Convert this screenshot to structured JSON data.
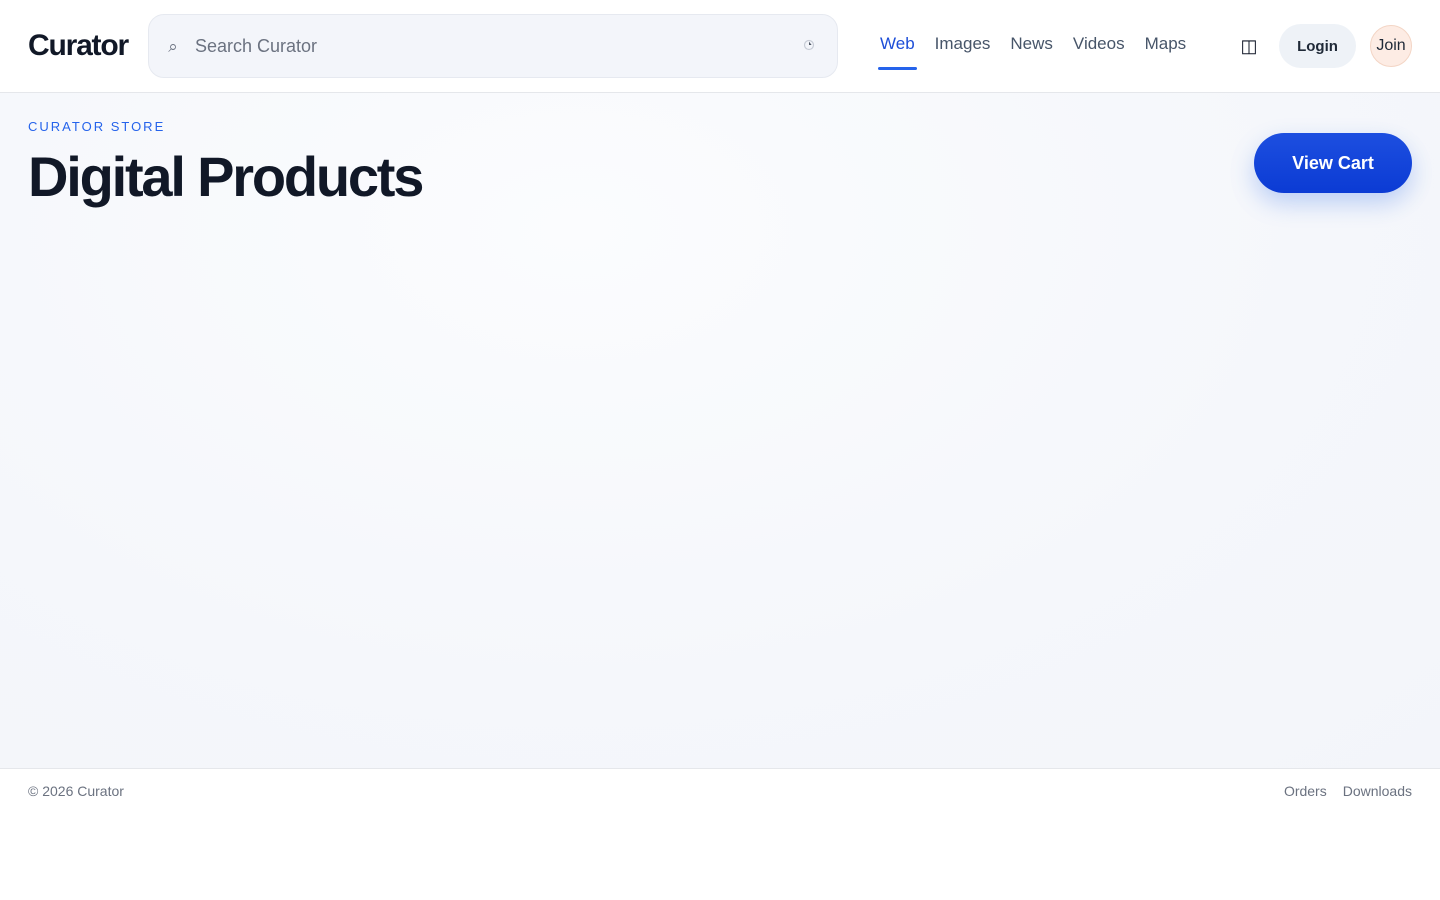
{
  "header": {
    "logo": "Curator",
    "search": {
      "placeholder": "Search Curator",
      "value": ""
    },
    "tabs": [
      {
        "label": "Web",
        "active": true
      },
      {
        "label": "Images",
        "active": false
      },
      {
        "label": "News",
        "active": false
      },
      {
        "label": "Videos",
        "active": false
      },
      {
        "label": "Maps",
        "active": false
      }
    ],
    "layout_icon": "◫",
    "login_label": "Login",
    "join_label": "Join"
  },
  "hero": {
    "eyebrow": "CURATOR STORE",
    "title": "Digital Products",
    "cart_label": "View Cart"
  },
  "footer": {
    "copyright": "© 2026 Curator",
    "links": [
      {
        "label": "Orders"
      },
      {
        "label": "Downloads"
      }
    ]
  },
  "icons": {
    "search": "search-icon",
    "voice": "microphone-icon",
    "layout": "layout-icon"
  },
  "colors": {
    "accent": "#2563eb",
    "cart_button": "#0b3bd4",
    "join_bg": "#fdece4",
    "text": "#111827",
    "muted": "#6b7280"
  }
}
